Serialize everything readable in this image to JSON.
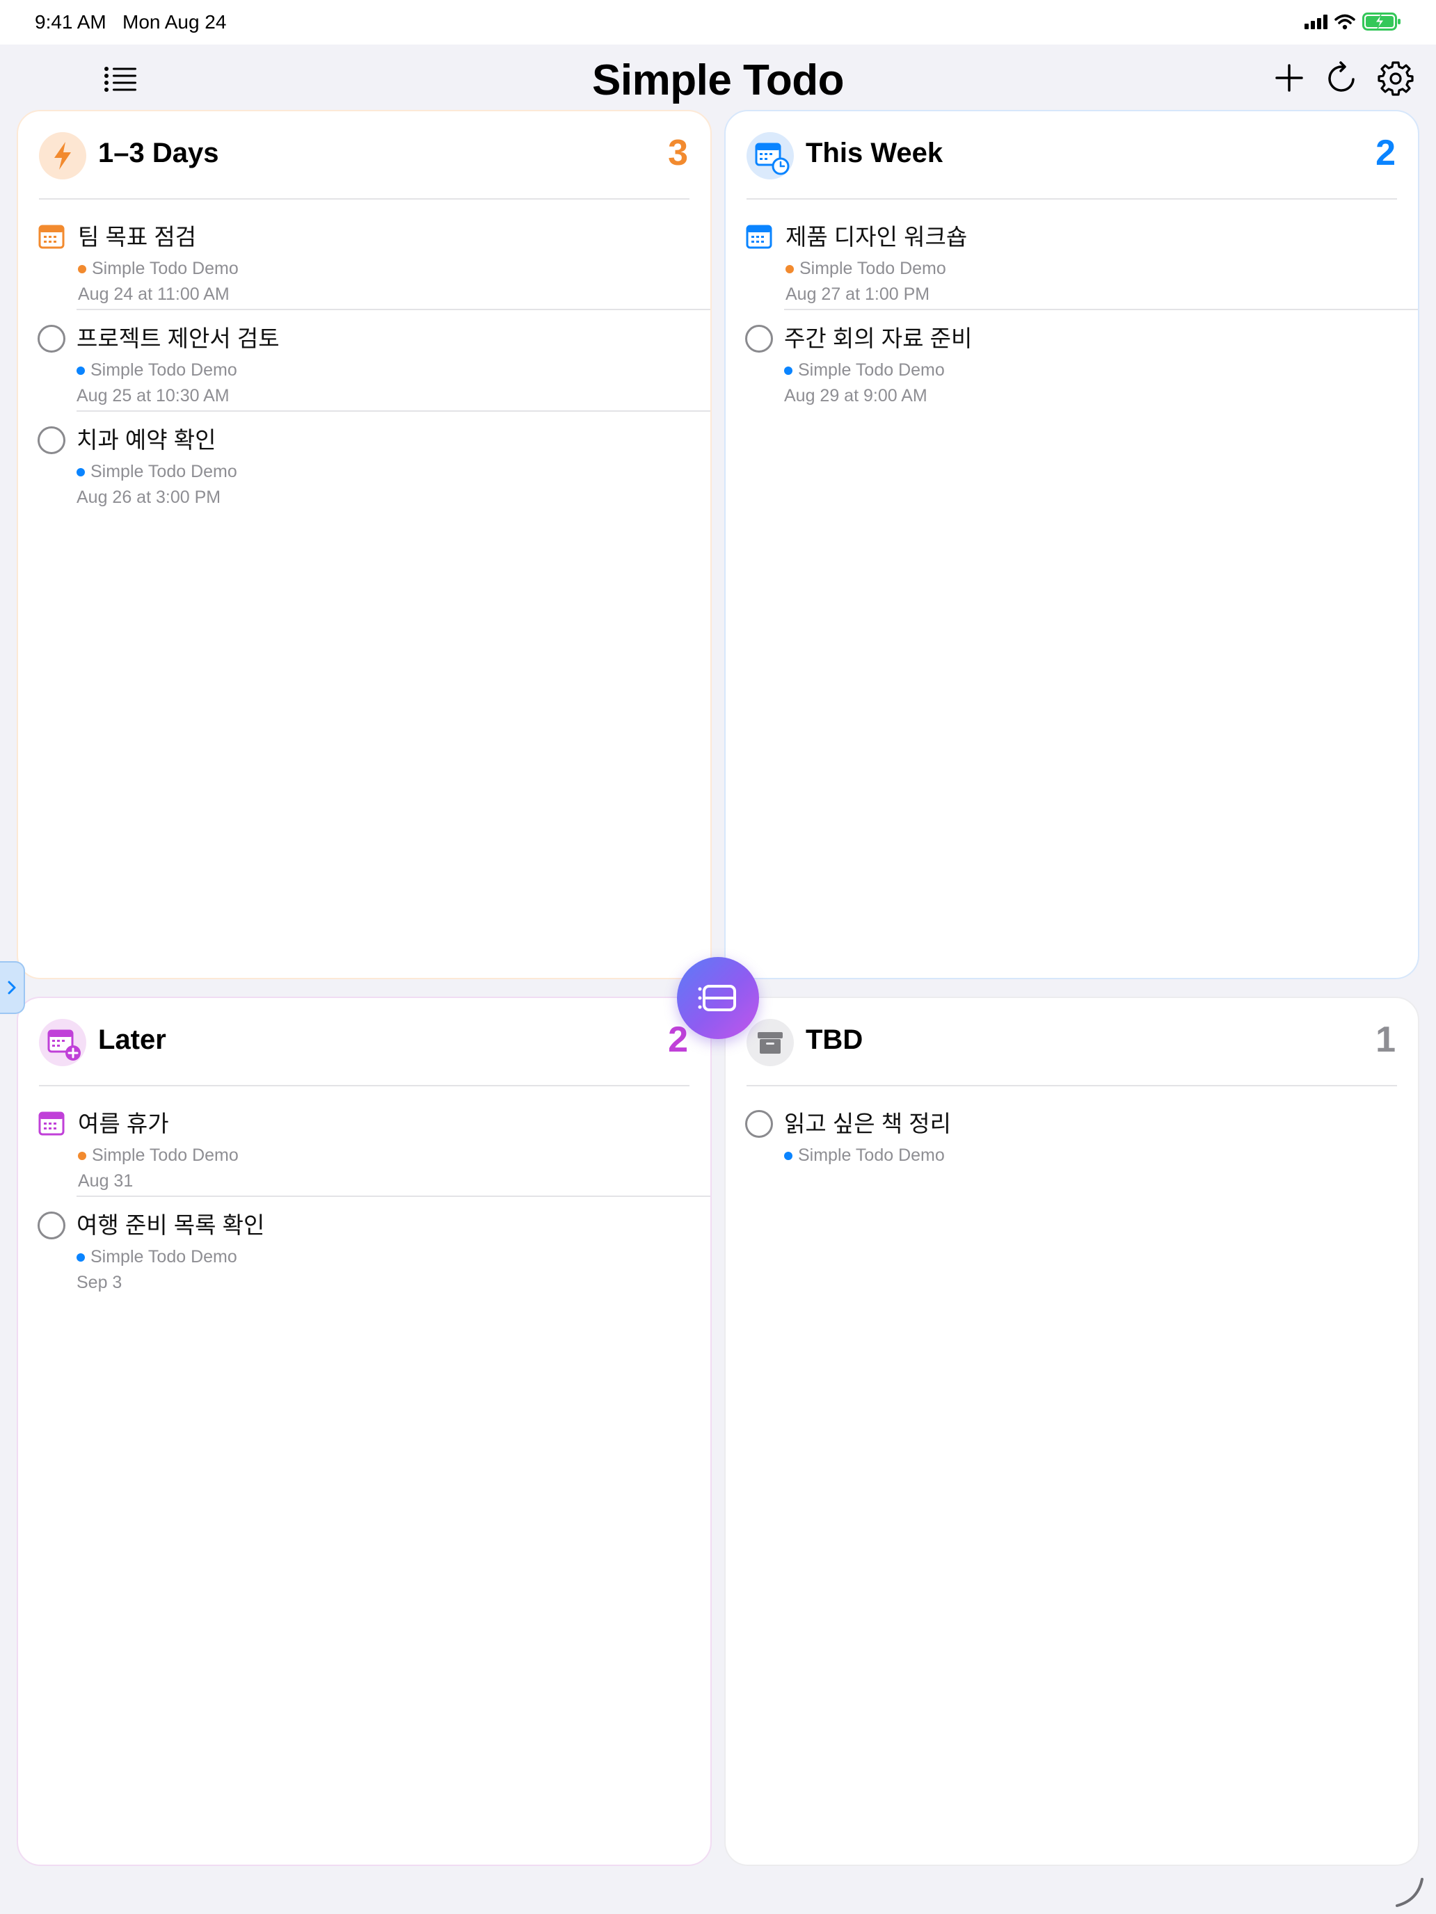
{
  "status_bar": {
    "time": "9:41 AM",
    "date": "Mon Aug 24",
    "icons": [
      "cellular-signal-icon",
      "wifi-icon",
      "battery-charging-icon"
    ]
  },
  "navbar": {
    "title": "Simple Todo",
    "left_icon": "list-icon",
    "right_icons": [
      "plus-icon",
      "refresh-icon",
      "gear-icon"
    ]
  },
  "colors": {
    "orange": "#f28a2e",
    "blue": "#0a84ff",
    "purple": "#c040d8",
    "gray": "#8e8e93"
  },
  "panels": [
    {
      "title": "1–3 Days",
      "count": "3",
      "icon": "bolt-icon",
      "tasks": [
        {
          "title": "팀 목표 점검",
          "list": "Simple Todo Demo",
          "date": "Aug 24 at 11:00 AM",
          "kind": "event",
          "dot": "orange"
        },
        {
          "title": "프로젝트 제안서 검토",
          "list": "Simple Todo Demo",
          "date": "Aug 25 at 10:30 AM",
          "kind": "reminder",
          "dot": "blue"
        },
        {
          "title": "치과 예약 확인",
          "list": "Simple Todo Demo",
          "date": "Aug 26 at 3:00 PM",
          "kind": "reminder",
          "dot": "blue"
        }
      ]
    },
    {
      "title": "This Week",
      "count": "2",
      "icon": "calendar-clock-icon",
      "tasks": [
        {
          "title": "제품 디자인 워크숍",
          "list": "Simple Todo Demo",
          "date": "Aug 27 at 1:00 PM",
          "kind": "event",
          "dot": "orange"
        },
        {
          "title": "주간 회의 자료 준비",
          "list": "Simple Todo Demo",
          "date": "Aug 29 at 9:00 AM",
          "kind": "reminder",
          "dot": "blue"
        }
      ]
    },
    {
      "title": "Later",
      "count": "2",
      "icon": "calendar-plus-icon",
      "tasks": [
        {
          "title": "여름 휴가",
          "list": "Simple Todo Demo",
          "date": "Aug 31",
          "kind": "event",
          "dot": "orange"
        },
        {
          "title": "여행 준비 목록 확인",
          "list": "Simple Todo Demo",
          "date": "Sep 3",
          "kind": "reminder",
          "dot": "blue"
        }
      ]
    },
    {
      "title": "TBD",
      "count": "1",
      "icon": "archive-box-icon",
      "tasks": [
        {
          "title": "읽고 싶은 책 정리",
          "list": "Simple Todo Demo",
          "kind": "reminder",
          "dot": "blue"
        }
      ]
    }
  ],
  "floating_button_icon": "list-layout-icon",
  "side_tab_icon": "chevron-right-icon"
}
